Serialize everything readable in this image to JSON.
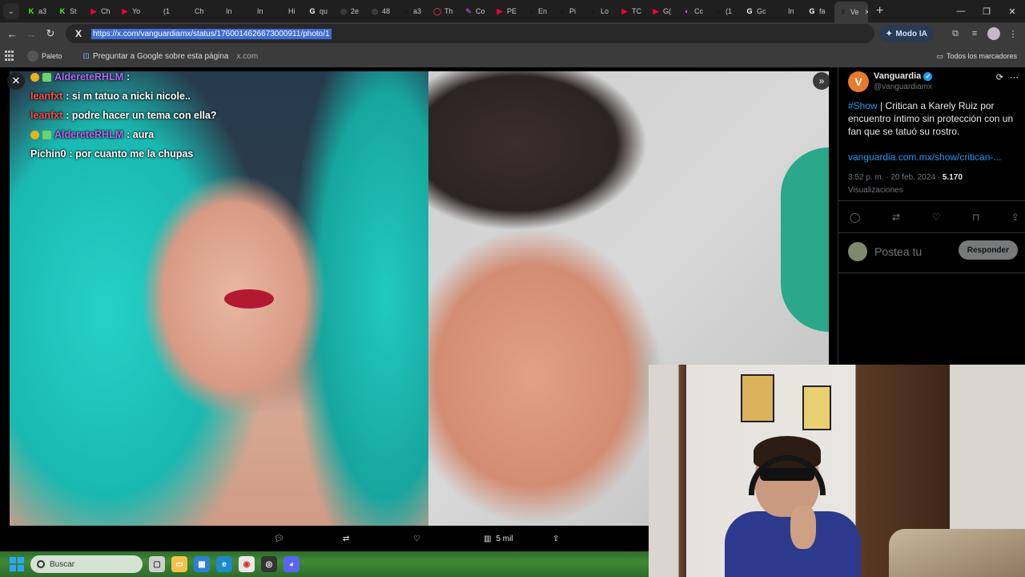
{
  "browser": {
    "tabs": [
      {
        "icon": "K",
        "color": "#53fc18",
        "label": "a3"
      },
      {
        "icon": "K",
        "color": "#53fc18",
        "label": "St"
      },
      {
        "icon": "▶",
        "color": "#ff0033",
        "label": "Ch"
      },
      {
        "icon": "▶",
        "color": "#ff0033",
        "label": "Yo"
      },
      {
        "icon": "X",
        "color": "#222222",
        "label": "(1"
      },
      {
        "icon": "X",
        "color": "#222222",
        "label": "Ch"
      },
      {
        "icon": "X",
        "color": "#222222",
        "label": "In"
      },
      {
        "icon": "X",
        "color": "#222222",
        "label": "In"
      },
      {
        "icon": "X",
        "color": "#222222",
        "label": "Hi"
      },
      {
        "icon": "G",
        "color": "#ffffff",
        "label": "qu"
      },
      {
        "icon": "◎",
        "color": "#555555",
        "label": "2e"
      },
      {
        "icon": "◎",
        "color": "#555555",
        "label": "48"
      },
      {
        "icon": "♪",
        "color": "#111111",
        "label": "a3"
      },
      {
        "icon": "◯",
        "color": "#c0392b",
        "label": "Th"
      },
      {
        "icon": "✎",
        "color": "#8e44ad",
        "label": "Co"
      },
      {
        "icon": "▶",
        "color": "#ff0033",
        "label": "PE"
      },
      {
        "icon": "♪",
        "color": "#111111",
        "label": "En"
      },
      {
        "icon": "♪",
        "color": "#111111",
        "label": "Pi"
      },
      {
        "icon": "♪",
        "color": "#111111",
        "label": "Lo"
      },
      {
        "icon": "▶",
        "color": "#ff0033",
        "label": "TC"
      },
      {
        "icon": "▶",
        "color": "#ff0033",
        "label": "G("
      },
      {
        "icon": "◐",
        "color": "#e056fd",
        "label": "Cc"
      },
      {
        "icon": "♪",
        "color": "#111111",
        "label": "(1"
      },
      {
        "icon": "G",
        "color": "#ffffff",
        "label": "Gc"
      },
      {
        "icon": "X",
        "color": "#222222",
        "label": "In"
      },
      {
        "icon": "G",
        "color": "#ffffff",
        "label": "fa"
      },
      {
        "icon": "X",
        "color": "#222222",
        "label": "Ve"
      }
    ],
    "url": "https://x.com/vanguardiamx/status/1760014626673000911/photo/1",
    "modo_ia": "Modo IA",
    "bookmark_paleto": "Paleto",
    "ask_google": "Preguntar a Google sobre esta página",
    "site_hint": "x.com",
    "all_bookmarks": "Todos los marcadores"
  },
  "chat": [
    {
      "user": "AldereteRHLM",
      "user_color": "purple",
      "msg": ":",
      "badges": true
    },
    {
      "user": "leanfxt",
      "user_color": "red",
      "msg": ": si m tatuo a nicki nicole..",
      "badges": false
    },
    {
      "user": "leanfxt",
      "user_color": "red",
      "msg": ": podre hacer un tema con ella?",
      "badges": false
    },
    {
      "user": "AldereteRHLM",
      "user_color": "purple",
      "msg": ": aura",
      "badges": true
    },
    {
      "user": "Pichin0",
      "user_color": "white",
      "msg": ": por cuanto me la chupas",
      "badges": false
    }
  ],
  "photo_actions": {
    "views": "5 mil"
  },
  "tweet": {
    "avatar_letter": "V",
    "name": "Vanguardia",
    "handle": "@vanguardiamx",
    "hashtag": "#Show",
    "text": " | Critican a Karely Ruiz por encuentro íntimo sin protección con un fan que se tatuó su rostro.",
    "link": "vanguardia.com.mx/show/critican-...",
    "time": "3:52 p. m. · 20 feb. 2024 · ",
    "views_count": "5.170",
    "views_label": "Visualizaciones",
    "reply_placeholder": "Postea tu",
    "reply_button": "Responder"
  },
  "taskbar": {
    "search_placeholder": "Buscar"
  }
}
